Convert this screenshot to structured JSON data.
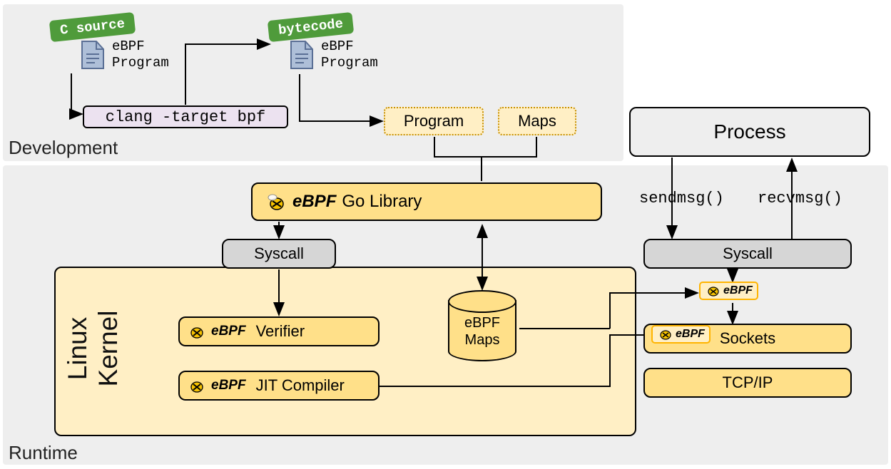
{
  "regions": {
    "development": "Development",
    "runtime": "Runtime"
  },
  "files": {
    "csource": {
      "tag": "C source",
      "line1": "eBPF",
      "line2": "Program"
    },
    "bytecode": {
      "tag": "bytecode",
      "line1": "eBPF",
      "line2": "Program"
    }
  },
  "clang": "clang -target bpf",
  "program": "Program",
  "mapsTop": "Maps",
  "goLib": "Go Library",
  "syscall1": "Syscall",
  "syscall2": "Syscall",
  "verifier": "Verifier",
  "jit": "JIT Compiler",
  "ebpfMaps": "eBPF\nMaps",
  "sockets": "Sockets",
  "tcpip": "TCP/IP",
  "process": "Process",
  "sendmsg": "sendmsg()",
  "recvmsg": "recvmsg()",
  "kernelTitle": "Linux\nKernel",
  "ebpfLogo": "eBPF"
}
